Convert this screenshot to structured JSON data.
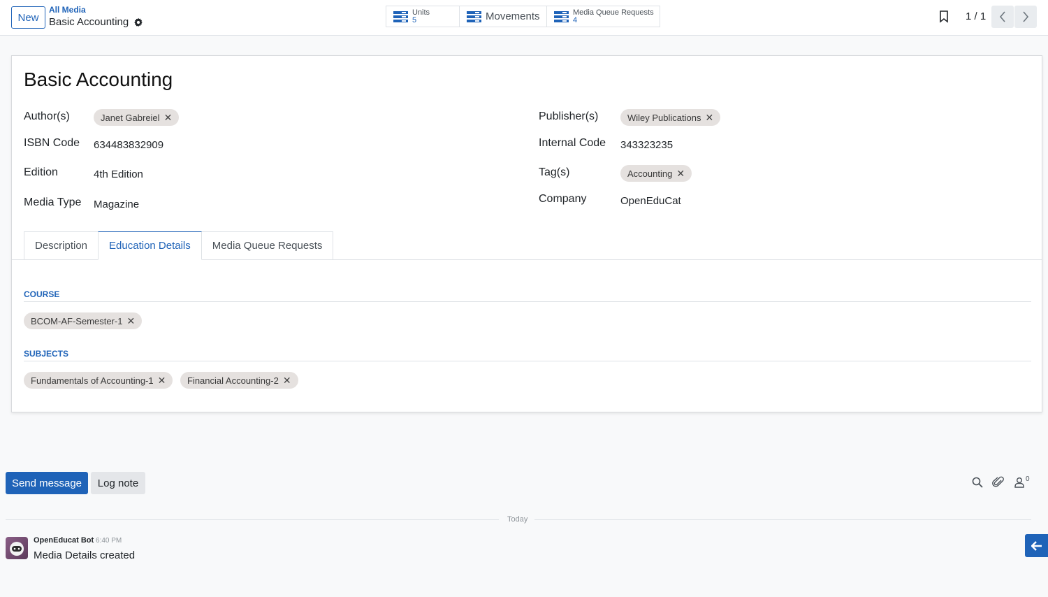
{
  "control_panel": {
    "new_label": "New",
    "breadcrumb_parent": "All Media",
    "breadcrumb_current": "Basic Accounting",
    "smart_buttons": [
      {
        "label": "Units",
        "count": "5",
        "icon": "list-icon"
      },
      {
        "label": "Movements",
        "icon": "list-icon"
      },
      {
        "label": "Media Queue Requests",
        "count": "4",
        "icon": "list-icon"
      }
    ],
    "pager": "1 / 1"
  },
  "form": {
    "title": "Basic Accounting",
    "fields": {
      "authors_label": "Author(s)",
      "authors": [
        "Janet Gabreiel"
      ],
      "isbn_label": "ISBN Code",
      "isbn": "634483832909",
      "edition_label": "Edition",
      "edition": "4th Edition",
      "media_type_label": "Media Type",
      "media_type": "Magazine",
      "publishers_label": "Publisher(s)",
      "publishers": [
        "Wiley Publications"
      ],
      "internal_code_label": "Internal Code",
      "internal_code": "343323235",
      "tags_label": "Tag(s)",
      "tags": [
        "Accounting"
      ],
      "company_label": "Company",
      "company": "OpenEduCat"
    },
    "tabs": [
      "Description",
      "Education Details",
      "Media Queue Requests"
    ],
    "active_tab": "Education Details",
    "course_title": "COURSE",
    "courses": [
      "BCOM-AF-Semester-1"
    ],
    "subjects_title": "SUBJECTS",
    "subjects": [
      "Fundamentals of Accounting-1",
      "Financial Accounting-2"
    ],
    "remove_glyph": "✕"
  },
  "chatter": {
    "send_message": "Send message",
    "log_note": "Log note",
    "followers_count": "0",
    "date_separator": "Today",
    "messages": [
      {
        "author": "OpenEducat Bot",
        "time": "6:40 PM",
        "body": "Media Details created"
      }
    ]
  },
  "colors": {
    "accent": "#1f63b8",
    "tag_bg": "#e5e1df",
    "page_bg": "#f8f9fa"
  }
}
